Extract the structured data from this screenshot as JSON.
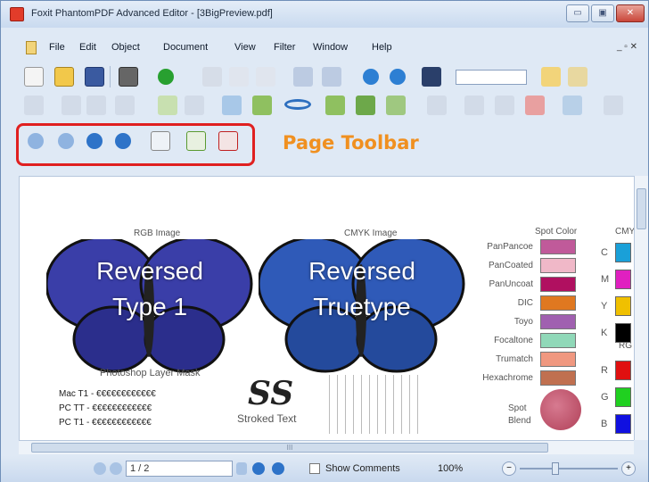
{
  "window": {
    "title": "Foxit PhantomPDF Advanced Editor - [3BigPreview.pdf]",
    "min_glyph": "▭",
    "max_glyph": "▣",
    "close_glyph": "✕",
    "mdi_controls": "_ ▫ ✕"
  },
  "menu": {
    "file": "File",
    "edit": "Edit",
    "object": "Object",
    "document": "Document",
    "view": "View",
    "filter": "Filter",
    "window": "Window",
    "help": "Help"
  },
  "annotation": {
    "page_toolbar": "Page Toolbar"
  },
  "document": {
    "rgb_label": "RGB Image",
    "cmyk_label": "CMYK Image",
    "rgb_text": [
      "Reversed",
      "Type 1"
    ],
    "cmyk_text": [
      "Reversed",
      "Truetype"
    ],
    "photoshop": "Photoshop Layer Mask",
    "mac_line": "Mac T1 - €€€€€€€€€€€€",
    "pc_tt": "PC TT - €€€€€€€€€€€€",
    "pc_t1": "PC T1 - €€€€€€€€€€€€",
    "ss": "SS",
    "stroked": "Stroked Text",
    "spot_color": "Spot Color",
    "cmyk_short": "CMY",
    "rgb_short": "RG",
    "spot_rows": [
      {
        "name": "PanPancoe",
        "color": "#c05a9a"
      },
      {
        "name": "PanCoated",
        "color": "#f0b8c8"
      },
      {
        "name": "PanUncoat",
        "color": "#b01060"
      },
      {
        "name": "DIC",
        "color": "#e07820"
      },
      {
        "name": "Toyo",
        "color": "#a060b0"
      },
      {
        "name": "Focaltone",
        "color": "#90d8b8"
      },
      {
        "name": "Trumatch",
        "color": "#f09880"
      },
      {
        "name": "Hexachrome",
        "color": "#c07050"
      }
    ],
    "cmyk_letters": [
      "C",
      "M",
      "Y",
      "K"
    ],
    "cmyk_colors": [
      "#1aa0d8",
      "#e020c0",
      "#f0c000",
      "#000000"
    ],
    "rgb_letters": [
      "R",
      "G",
      "B"
    ],
    "rgb_colors": [
      "#e01010",
      "#20d020",
      "#1010e0"
    ],
    "spot_blend": [
      "Spot",
      "Blend"
    ]
  },
  "scroll": {
    "h_grip": "III"
  },
  "status": {
    "page": "1 / 2",
    "show_comments": "Show Comments",
    "zoom": "100%",
    "zoom_out": "−",
    "zoom_in": "+"
  }
}
